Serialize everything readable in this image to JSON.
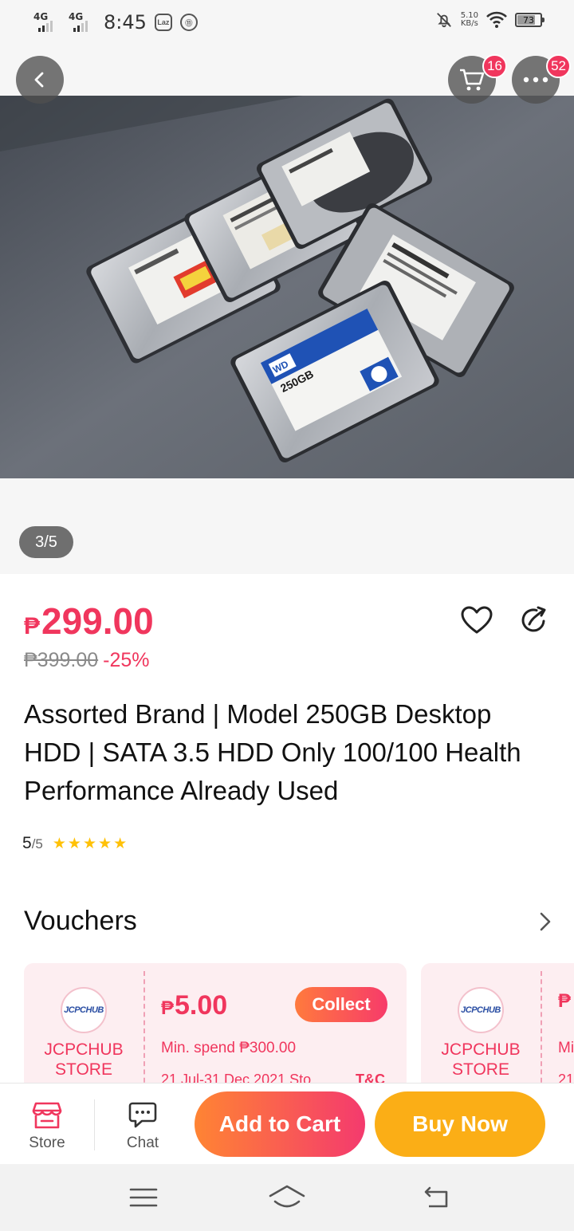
{
  "status_bar": {
    "signal1": "4G",
    "signal2": "4G",
    "time": "8:45",
    "app_icon1": "Laz",
    "app_icon2": "⑪",
    "net_speed_value": "5.10",
    "net_speed_unit": "KB/s",
    "battery": "73",
    "battery_level": 0.73
  },
  "header": {
    "cart_badge": "16",
    "more_badge": "52"
  },
  "gallery": {
    "counter": "3/5"
  },
  "product": {
    "currency": "₱",
    "price": "299.00",
    "original_price": "₱399.00",
    "discount": "-25%",
    "title": "Assorted Brand | Model 250GB Desktop HDD | SATA 3.5 HDD Only 100/100 Health Performance Already Used",
    "rating": "5",
    "rating_max": "/5",
    "stars": 5
  },
  "vouchers": {
    "title": "Vouchers",
    "items": [
      {
        "logo": "JCPCHUB",
        "store": "JCPCHUB STORE",
        "currency": "₱",
        "amount": "5.00",
        "min_spend": "Min. spend ₱300.00",
        "date": "21 Jul-31 Dec 2021 Sto...",
        "tc": "T&C",
        "collect": "Collect"
      },
      {
        "logo": "JCPCHUB",
        "store": "JCPCHUB STORE",
        "currency": "₱",
        "min_spend": "Mi",
        "date": "21"
      }
    ]
  },
  "bottom_bar": {
    "store_label": "Store",
    "chat_label": "Chat",
    "add_to_cart": "Add to Cart",
    "buy_now": "Buy Now"
  },
  "colors": {
    "accent": "#f0365d",
    "add_to_cart_start": "#ff8433",
    "add_to_cart_end": "#f43a6e",
    "buy_now": "#fbae16",
    "stars": "#ffc107"
  },
  "icons": [
    "back-icon",
    "cart-icon",
    "more-icon",
    "heart-icon",
    "share-icon",
    "chevron-right-icon",
    "store-icon",
    "chat-icon",
    "menu-icon",
    "home-icon",
    "nav-back-icon"
  ]
}
